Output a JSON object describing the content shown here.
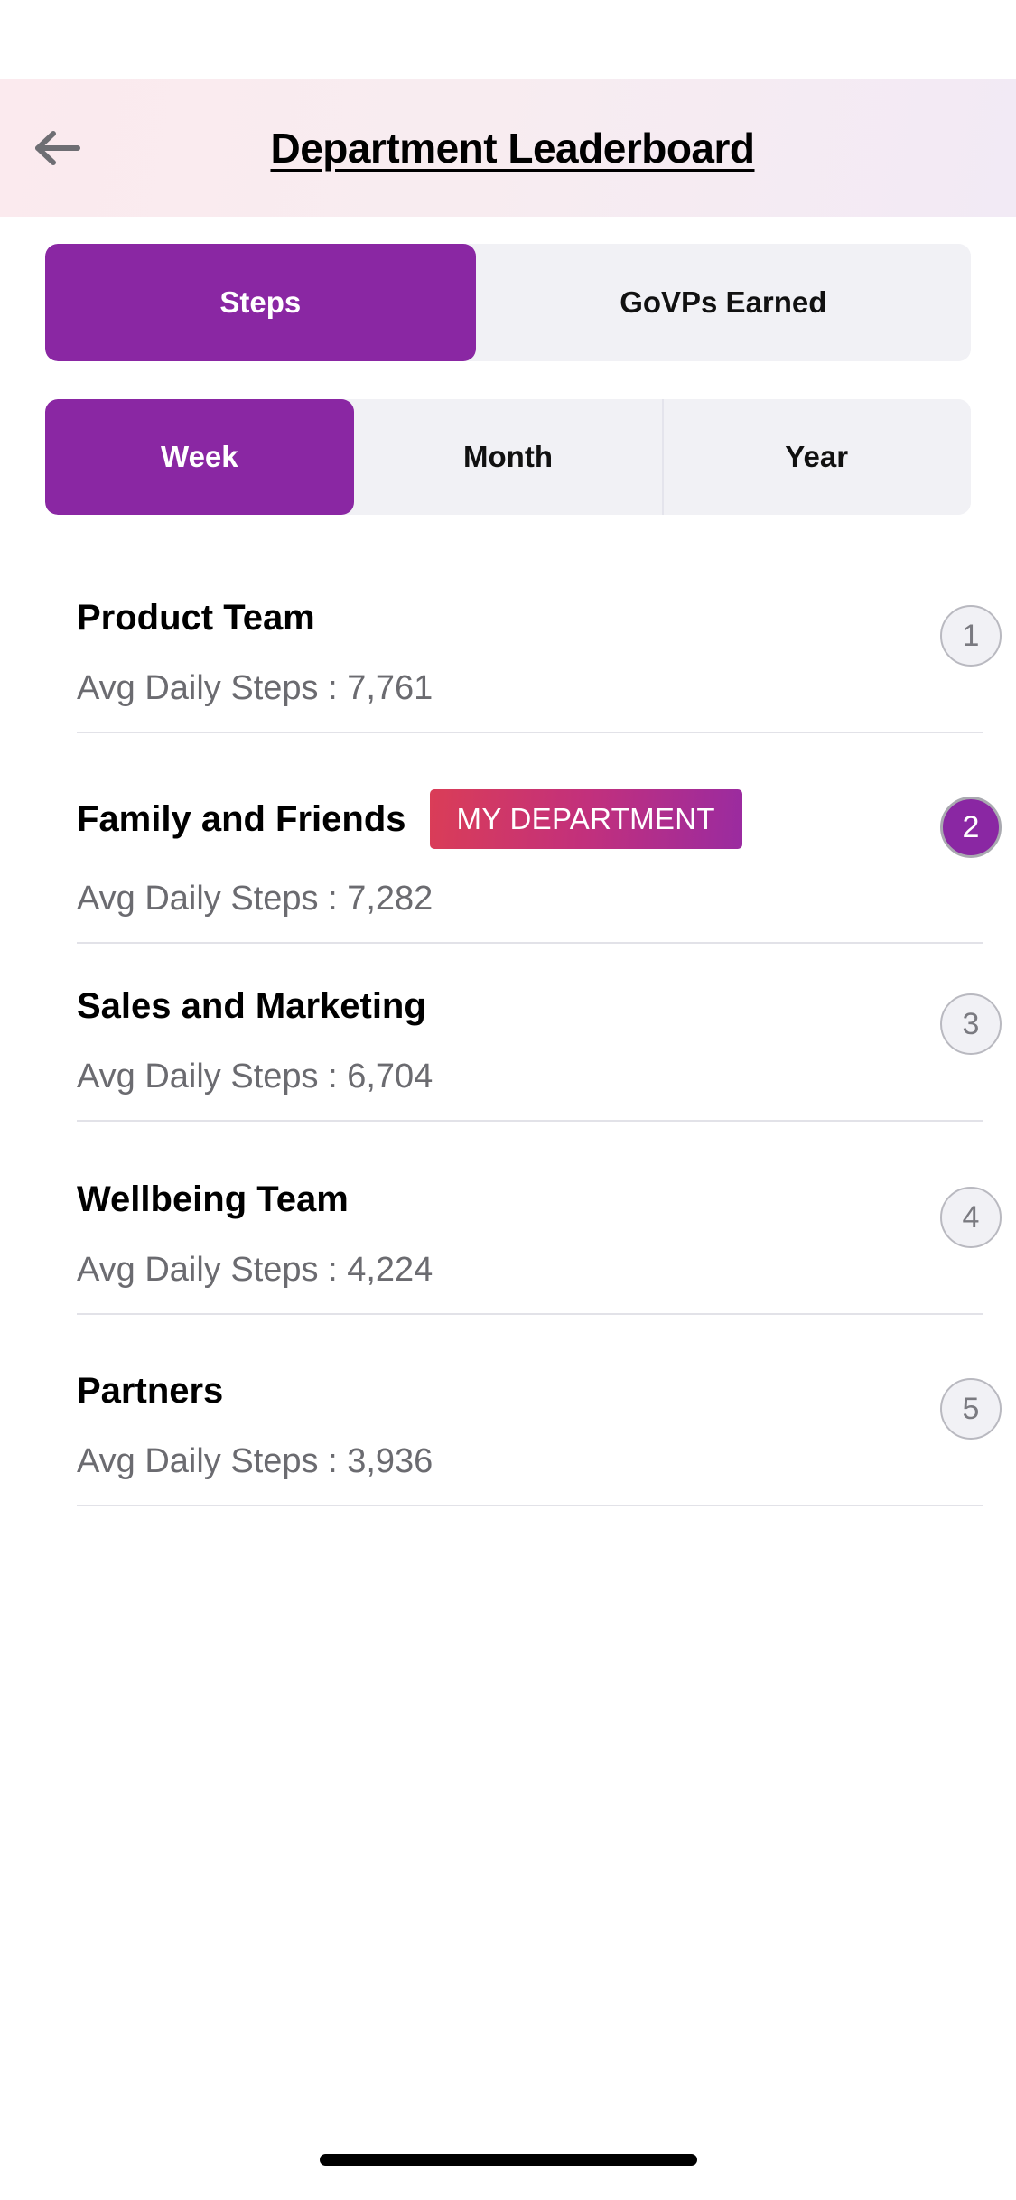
{
  "header": {
    "title": "Department Leaderboard",
    "back_icon": "arrow-left-icon"
  },
  "metric_tabs": {
    "selected": "Steps",
    "items": [
      {
        "label": "Steps",
        "active": true
      },
      {
        "label": "GoVPs Earned",
        "active": false
      }
    ]
  },
  "period_tabs": {
    "selected": "Week",
    "items": [
      {
        "label": "Week",
        "active": true
      },
      {
        "label": "Month",
        "active": false
      },
      {
        "label": "Year",
        "active": false
      }
    ]
  },
  "leaderboard": {
    "rows": [
      {
        "rank": "1",
        "name": "Product Team",
        "steps_label": "Avg Daily Steps : 7,761",
        "is_my_department": false,
        "badge_label": ""
      },
      {
        "rank": "2",
        "name": "Family and Friends",
        "steps_label": "Avg Daily Steps : 7,282",
        "is_my_department": true,
        "badge_label": "MY DEPARTMENT"
      },
      {
        "rank": "3",
        "name": "Sales and Marketing",
        "steps_label": "Avg Daily Steps : 6,704",
        "is_my_department": false,
        "badge_label": ""
      },
      {
        "rank": "4",
        "name": "Wellbeing Team",
        "steps_label": "Avg Daily Steps : 4,224",
        "is_my_department": false,
        "badge_label": ""
      },
      {
        "rank": "5",
        "name": "Partners",
        "steps_label": "Avg Daily Steps : 3,936",
        "is_my_department": false,
        "badge_label": ""
      }
    ]
  },
  "colors": {
    "accent_purple": "#8A27A3",
    "badge_gradient_start": "#DA3D57",
    "badge_gradient_end": "#9A2BA0",
    "segment_inactive": "#F1F1F5",
    "header_gradient_start": "#FBEAEE",
    "header_gradient_end": "#F2EAF5",
    "muted_text": "#6B6B70"
  }
}
